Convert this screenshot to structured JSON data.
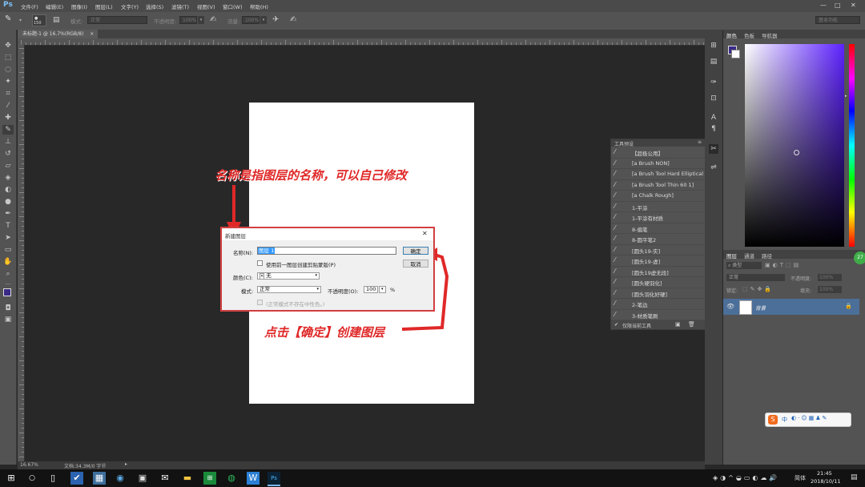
{
  "app": {
    "logo": "Ps"
  },
  "menu": [
    "文件(F)",
    "编辑(E)",
    "图像(I)",
    "图层(L)",
    "文字(Y)",
    "选择(S)",
    "滤镜(T)",
    "视图(V)",
    "窗口(W)",
    "帮助(H)"
  ],
  "window_controls": [
    "—",
    "□",
    "✕"
  ],
  "options_bar": {
    "brush_size": "150",
    "mode_label": "模式:",
    "mode_value": "正常",
    "opacity_label": "不透明度:",
    "opacity_value": "100%",
    "flow_label": "流量:",
    "flow_value": "100%",
    "workspace": "基本功能"
  },
  "document_tab": {
    "title": "未标题-1 @ 16.7%(RGB/8)",
    "close": "×"
  },
  "annotations": {
    "name_hint": "名称是指图层的名称，可以自己修改",
    "ok_hint": "点击【确定】创建图层"
  },
  "dialog": {
    "title": "新建图层",
    "name_label": "名称(N):",
    "name_value": "图层 1",
    "clip_checkbox_label": "使用前一图层创建剪贴蒙版(P)",
    "color_label": "颜色(C):",
    "color_value": "无",
    "color_swatch_glyph": "✕",
    "mode_label": "模式:",
    "mode_value": "正常",
    "opacity_label": "不透明度(O):",
    "opacity_value": "100",
    "opacity_unit": "%",
    "neutral_label": "(正常模式不存在中性色。)",
    "ok_button": "确定",
    "cancel_button": "取消",
    "close": "✕"
  },
  "presets_panel": {
    "title": "工具预设",
    "items": [
      "【超极公用】",
      "[a Brush NON]",
      "[a Brush Tool Hard Elliptical",
      "[a Brush Tool Thin 60 1]",
      "[a Chalk Rough]",
      "1-平涂",
      "1-平涂有材质",
      "8-偏笔",
      "8-圆平笔2",
      "[圆头19-实]",
      "[圆头19-虚]",
      "[圆头19虚无段]",
      "[圆头硬羽化]",
      "[圆头羽化好硬]",
      "2-笔边",
      "3-材质笔刷"
    ],
    "footer_checkbox": "仅限当前工具"
  },
  "color_panel": {
    "tabs": [
      "颜色",
      "色板",
      "导航器"
    ]
  },
  "layers_panel": {
    "tabs": [
      "图层",
      "通道",
      "路径"
    ],
    "kind_label": "类型",
    "blend_mode": "正常",
    "opacity_label": "不透明度:",
    "opacity_value": "100%",
    "lock_label": "锁定:",
    "fill_label": "填充:",
    "fill_value": "100%",
    "layer_name": "背景",
    "badge": "27"
  },
  "status_bar": {
    "zoom": "16.67%",
    "doc_info": "文档:34.3M/0 字节"
  },
  "taskbar": {
    "time": "21:45",
    "date": "2018/10/11",
    "ime": "简体"
  },
  "ime_bar": {
    "text": "中"
  },
  "colors": {
    "accent": "#4c6f9a",
    "annotation": "#e02828",
    "fg_swatch": "#3a2a86"
  }
}
